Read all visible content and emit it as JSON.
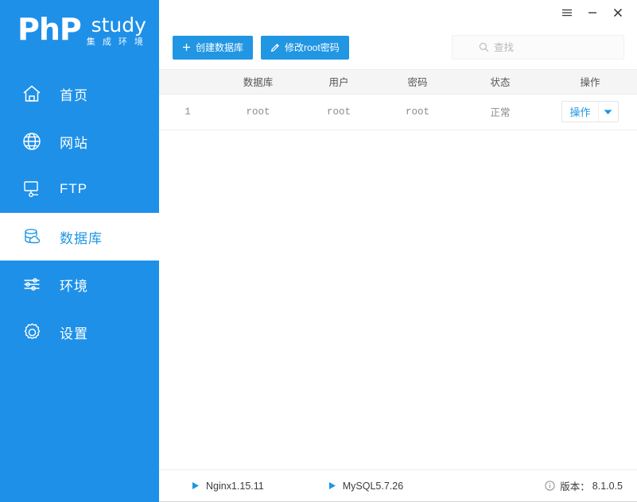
{
  "brand": {
    "name_main": "PhP",
    "name_sub": "study",
    "tagline": "集 成 环 境",
    "color": "#1e90e8"
  },
  "window": {
    "menu_icon": "hamburger-menu-icon",
    "minimize_icon": "minimize-icon",
    "close_icon": "close-icon"
  },
  "sidebar": {
    "items": [
      {
        "label": "首页",
        "icon": "home-icon",
        "active": false
      },
      {
        "label": "网站",
        "icon": "globe-icon",
        "active": false
      },
      {
        "label": "FTP",
        "icon": "ftp-icon",
        "active": false
      },
      {
        "label": "数据库",
        "icon": "database-icon",
        "active": true
      },
      {
        "label": "环境",
        "icon": "sliders-icon",
        "active": false
      },
      {
        "label": "设置",
        "icon": "gear-icon",
        "active": false
      }
    ]
  },
  "toolbar": {
    "create_db_label": "创建数据库",
    "create_db_icon": "plus-icon",
    "change_pwd_label": "修改root密码",
    "change_pwd_icon": "pencil-icon",
    "accent_color": "#2196e3"
  },
  "search": {
    "placeholder": "查找",
    "value": "",
    "icon": "search-icon"
  },
  "table": {
    "columns": [
      "",
      "数据库",
      "用户",
      "密码",
      "状态",
      "操作"
    ],
    "rows": [
      {
        "index": "1",
        "database": "root",
        "user": "root",
        "password": "root",
        "status": "正常",
        "action_label": "操作",
        "action_icon": "chevron-down-icon"
      }
    ]
  },
  "statusbar": {
    "services": [
      {
        "name": "Nginx1.15.11",
        "icon": "play-icon"
      },
      {
        "name": "MySQL5.7.26",
        "icon": "play-icon"
      }
    ],
    "version_icon": "info-icon",
    "version_label": "版本：",
    "version_value": "8.1.0.5"
  }
}
